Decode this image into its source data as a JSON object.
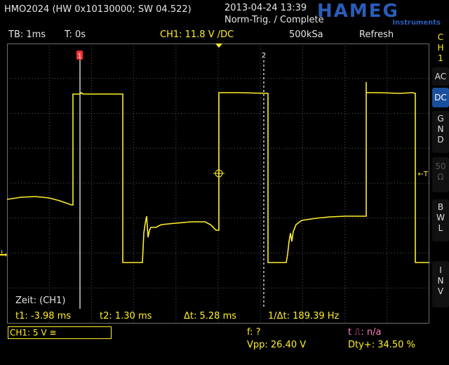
{
  "header": {
    "device": "HMO2024 (HW 0x10130000; SW 04.522)",
    "datetime": "2013-04-24 13:39",
    "trigger_status": "Norm-Trig. / Complete",
    "brand": "HAMEG",
    "brand_sub": "Instruments"
  },
  "info": {
    "timebase": "TB: 1ms",
    "trigger_time": "T: 0s",
    "channel_setting": "CH1: 11.8 V /DC",
    "sample_rate": "500kSa",
    "mode": "Refresh"
  },
  "screen": {
    "cursor1_label": "1",
    "cursor2_label": "2",
    "channel_marker": "1",
    "trigger_marker": "←T",
    "measurement_title": "Zeit: (CH1)",
    "t1": "t1: -3.98 ms",
    "t2": "t2: 1.30 ms",
    "delta_t": "Δt: 5.28 ms",
    "inv_delta_t": "1/Δt: 189.39 Hz"
  },
  "sidebar": {
    "channel": [
      "C",
      "H",
      "1"
    ],
    "ac": "AC",
    "dc": "DC",
    "gnd": [
      "G",
      "N",
      "D"
    ],
    "fifty": [
      "50",
      "Ω"
    ],
    "bwl": [
      "B",
      "W",
      "L"
    ],
    "inv": [
      "I",
      "N",
      "V"
    ]
  },
  "footer": {
    "channel_box": "CH1: 5 V ≅",
    "freq": "f: ?",
    "pulse": "t ⎍: n/a",
    "vpp": "Vpp: 26.40 V",
    "duty": "Dty+: 34.50 %"
  },
  "colors": {
    "trace": "#ffef28",
    "grid": "#5a5a5a",
    "accent_pink": "#ff7bc3",
    "dc_active": "#1a4f9c"
  }
}
